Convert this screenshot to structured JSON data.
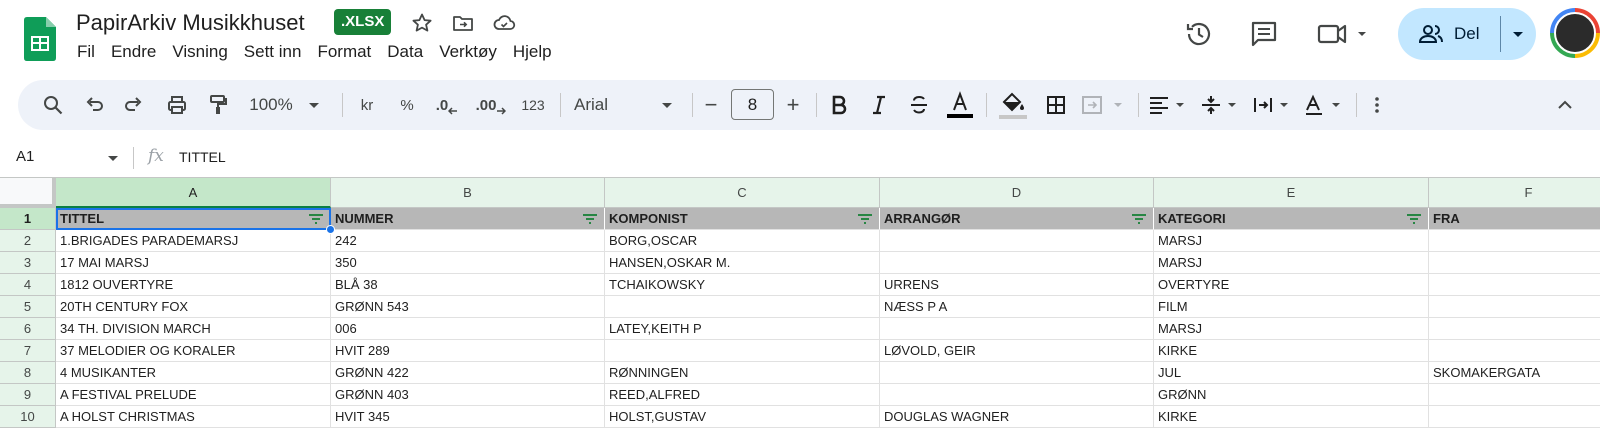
{
  "header": {
    "doc_title": "PapirArkiv Musikkhuset",
    "file_badge": ".XLSX",
    "menu": [
      "Fil",
      "Endre",
      "Visning",
      "Sett inn",
      "Format",
      "Data",
      "Verktøy",
      "Hjelp"
    ],
    "share_label": "Del",
    "icons": [
      "sheets-logo-icon",
      "star-icon",
      "move-to-folder-icon",
      "cloud-saved-icon",
      "version-history-icon",
      "comments-icon",
      "meet-video-icon",
      "people-icon"
    ]
  },
  "toolbar": {
    "zoom": "100%",
    "currency": "kr",
    "percent": "%",
    "decrease_decimals": ".0",
    "increase_decimals": ".00",
    "number_format": "123",
    "font": "Arial",
    "font_size": "8",
    "minus": "−",
    "plus": "+"
  },
  "formula_bar": {
    "name_box": "A1",
    "fx": "fx",
    "formula": "TITTEL"
  },
  "colors": {
    "accent_green": "#188038",
    "selection_blue": "#1a73e8",
    "header_gray": "#b7b7b7",
    "share_blue": "#c2e7ff"
  },
  "sheet": {
    "columns": [
      "A",
      "B",
      "C",
      "D",
      "E",
      "F"
    ],
    "rows": [
      "1",
      "2",
      "3",
      "4",
      "5",
      "6",
      "7",
      "8",
      "9",
      "10"
    ],
    "header_row": [
      "TITTEL",
      "NUMMER",
      "KOMPONIST",
      "ARRANGØR",
      "KATEGORI",
      "FRA"
    ],
    "data": [
      [
        "1.BRIGADES PARADEMARSJ",
        "242",
        "BORG,OSCAR",
        "",
        "MARSJ",
        ""
      ],
      [
        "17 MAI MARSJ",
        "350",
        "HANSEN,OSKAR M.",
        "",
        "MARSJ",
        ""
      ],
      [
        "1812 OUVERTYRE",
        "BLÅ  38",
        "TCHAIKOWSKY",
        "URRENS",
        "OVERTYRE",
        ""
      ],
      [
        "20TH CENTURY FOX",
        "GRØNN 543",
        "",
        "NÆSS P A",
        "FILM",
        ""
      ],
      [
        "34 TH. DIVISION MARCH",
        "006",
        "LATEY,KEITH P",
        "",
        "MARSJ",
        ""
      ],
      [
        "37 MELODIER OG KORALER",
        "HVIT 289",
        "",
        "LØVOLD, GEIR",
        "KIRKE",
        ""
      ],
      [
        "4 MUSIKANTER",
        "GRØNN 422",
        "RØNNINGEN",
        "",
        "JUL",
        "SKOMAKERGATA"
      ],
      [
        "A FESTIVAL PRELUDE",
        "GRØNN 403",
        "REED,ALFRED",
        "",
        "GRØNN",
        ""
      ],
      [
        "A HOLST CHRISTMAS",
        "HVIT 345",
        "HOLST,GUSTAV",
        "DOUGLAS WAGNER",
        "KIRKE",
        ""
      ]
    ]
  }
}
